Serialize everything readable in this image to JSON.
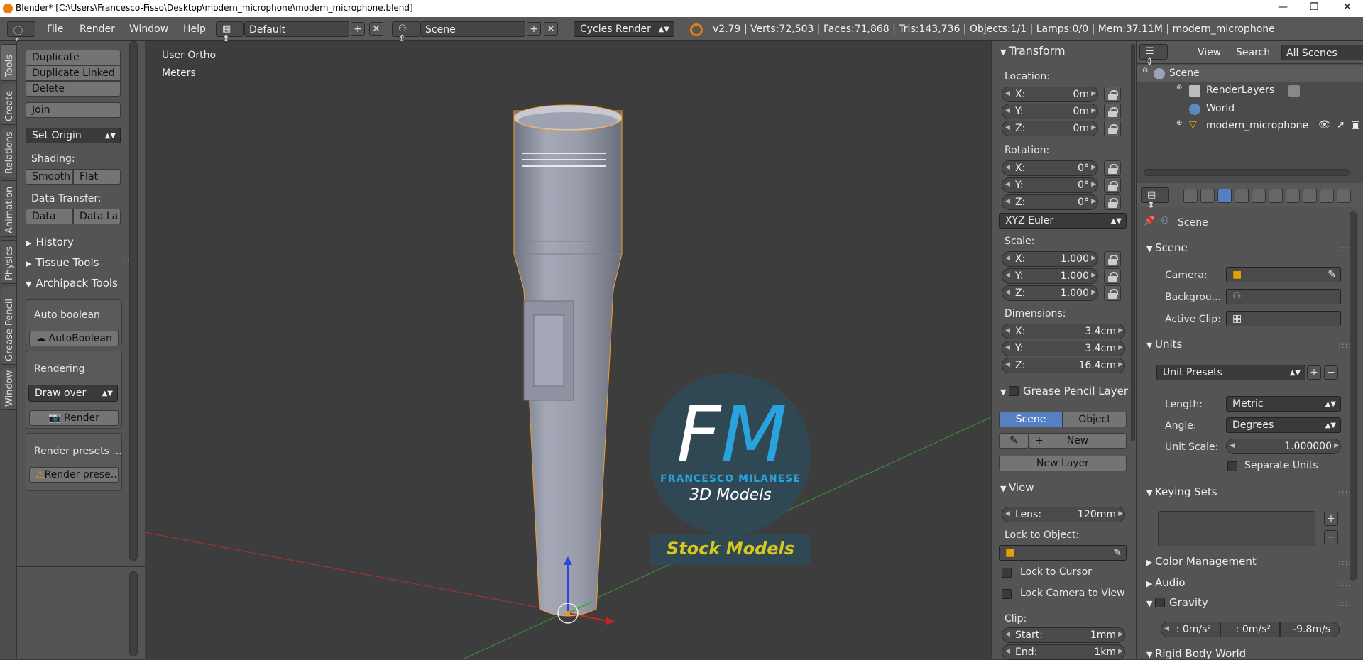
{
  "window": {
    "title": "Blender* [C:\\Users\\Francesco-Fisso\\Desktop\\modern_microphone\\modern_microphone.blend]",
    "minimize": "—",
    "maximize": "❐",
    "close": "✕"
  },
  "header": {
    "menus": [
      "File",
      "Render",
      "Window",
      "Help"
    ],
    "screen_layout": "Default",
    "scene": "Scene",
    "render_engine": "Cycles Render",
    "stats": "v2.79 | Verts:72,503 | Faces:71,868 | Tris:143,736 | Objects:1/1 | Lamps:0/0 | Mem:37.11M | modern_microphone"
  },
  "vertical_tabs": [
    "Tools",
    "Create",
    "Relations",
    "Animation",
    "Physics",
    "Grease Pencil",
    "Window"
  ],
  "toolshelf": {
    "buttons": [
      "Duplicate",
      "Duplicate Linked",
      "Delete",
      "Join"
    ],
    "set_origin": "Set Origin",
    "shading_label": "Shading:",
    "smooth": "Smooth",
    "flat": "Flat",
    "data_transfer_label": "Data Transfer:",
    "data": "Data",
    "data_la": "Data La",
    "history": "History",
    "tissue_tools": "Tissue Tools",
    "archipack_tools": "Archipack Tools",
    "auto_boolean_label": "Auto boolean",
    "auto_boolean_button": "AutoBoolean",
    "rendering_label": "Rendering",
    "draw_over": "Draw over",
    "render_button": "Render",
    "render_presets_label": "Render presets ...",
    "render_presets_button": "Render prese..."
  },
  "viewport": {
    "view_name": "User Ortho",
    "units": "Meters",
    "watermark_initials": "FM",
    "watermark_author": "FRANCESCO MILANESE",
    "watermark_sub": "3D Models",
    "watermark_banner": "Stock Models"
  },
  "npanel": {
    "transform": "Transform",
    "location_label": "Location:",
    "location": [
      {
        "k": "X:",
        "v": "0m"
      },
      {
        "k": "Y:",
        "v": "0m"
      },
      {
        "k": "Z:",
        "v": "0m"
      }
    ],
    "rotation_label": "Rotation:",
    "rotation": [
      {
        "k": "X:",
        "v": "0°"
      },
      {
        "k": "Y:",
        "v": "0°"
      },
      {
        "k": "Z:",
        "v": "0°"
      }
    ],
    "rotation_mode": "XYZ Euler",
    "scale_label": "Scale:",
    "scale": [
      {
        "k": "X:",
        "v": "1.000"
      },
      {
        "k": "Y:",
        "v": "1.000"
      },
      {
        "k": "Z:",
        "v": "1.000"
      }
    ],
    "dimensions_label": "Dimensions:",
    "dimensions": [
      {
        "k": "X:",
        "v": "3.4cm"
      },
      {
        "k": "Y:",
        "v": "3.4cm"
      },
      {
        "k": "Z:",
        "v": "16.4cm"
      }
    ],
    "gp_layer": "Grease Pencil Layer",
    "gp_scene": "Scene",
    "gp_object": "Object",
    "gp_new": "New",
    "gp_new_layer": "New Layer",
    "view": "View",
    "lens_k": "Lens:",
    "lens_v": "120mm",
    "lock_to_object": "Lock to Object:",
    "lock_to_cursor": "Lock to Cursor",
    "lock_camera": "Lock Camera to View",
    "clip_label": "Clip:",
    "clip_start_k": "Start:",
    "clip_start_v": "1mm",
    "clip_end_k": "End:",
    "clip_end_v": "1km"
  },
  "outliner": {
    "view": "View",
    "search": "Search",
    "all_scenes": "All Scenes",
    "items": [
      "Scene",
      "RenderLayers",
      "World",
      "modern_microphone"
    ]
  },
  "properties": {
    "context_name": "Scene",
    "scene_panel": "Scene",
    "camera_label": "Camera:",
    "background_label": "Backgrou...",
    "active_clip_label": "Active Clip:",
    "units_panel": "Units",
    "unit_presets": "Unit Presets",
    "length_label": "Length:",
    "length_value": "Metric",
    "angle_label": "Angle:",
    "angle_value": "Degrees",
    "unit_scale_label": "Unit Scale:",
    "unit_scale_value": "1.000000",
    "separate_units": "Separate Units",
    "keying_sets": "Keying Sets",
    "color_management": "Color Management",
    "audio": "Audio",
    "gravity": "Gravity",
    "gravity_x": ": 0m/s²",
    "gravity_y": ": 0m/s²",
    "gravity_z": "-9.8m/s",
    "rigid_body": "Rigid Body World"
  },
  "colors": {
    "accent_blue": "#5680c2",
    "watermark_blue": "#29a3dd",
    "banner_yellow": "#d6c81f",
    "selection_orange": "#f0a030"
  }
}
